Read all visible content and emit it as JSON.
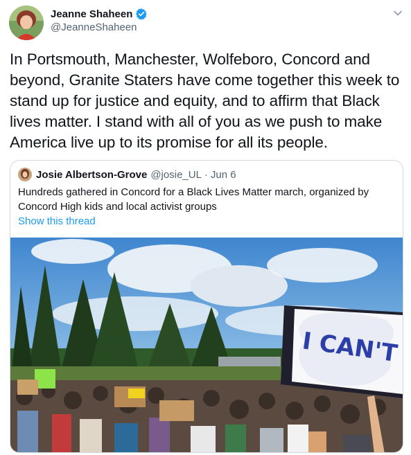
{
  "author": {
    "display_name": "Jeanne Shaheen",
    "handle": "@JeanneShaheen",
    "verified_icon": "verified-badge-icon"
  },
  "tweet": {
    "text": "In Portsmouth, Manchester, Wolfeboro, Concord and beyond, Granite Staters have come together this week to stand up for justice and equity, and to affirm that Black lives matter. I stand with all of you as we push to make America live up to its promise for all its people."
  },
  "quoted_tweet": {
    "display_name": "Josie Albertson-Grove",
    "handle": "@josie_UL",
    "separator": "·",
    "date": "Jun 6",
    "text": "Hundreds gathered in Concord for a Black Lives Matter march, organized by Concord High kids and local activist groups",
    "show_thread": "Show this thread",
    "media_sign_text": "I CAN'T BreaTh"
  },
  "colors": {
    "link": "#1d9bf0",
    "verified": "#1d9bf0",
    "secondary_text": "#536471",
    "border": "#cfd9de"
  }
}
